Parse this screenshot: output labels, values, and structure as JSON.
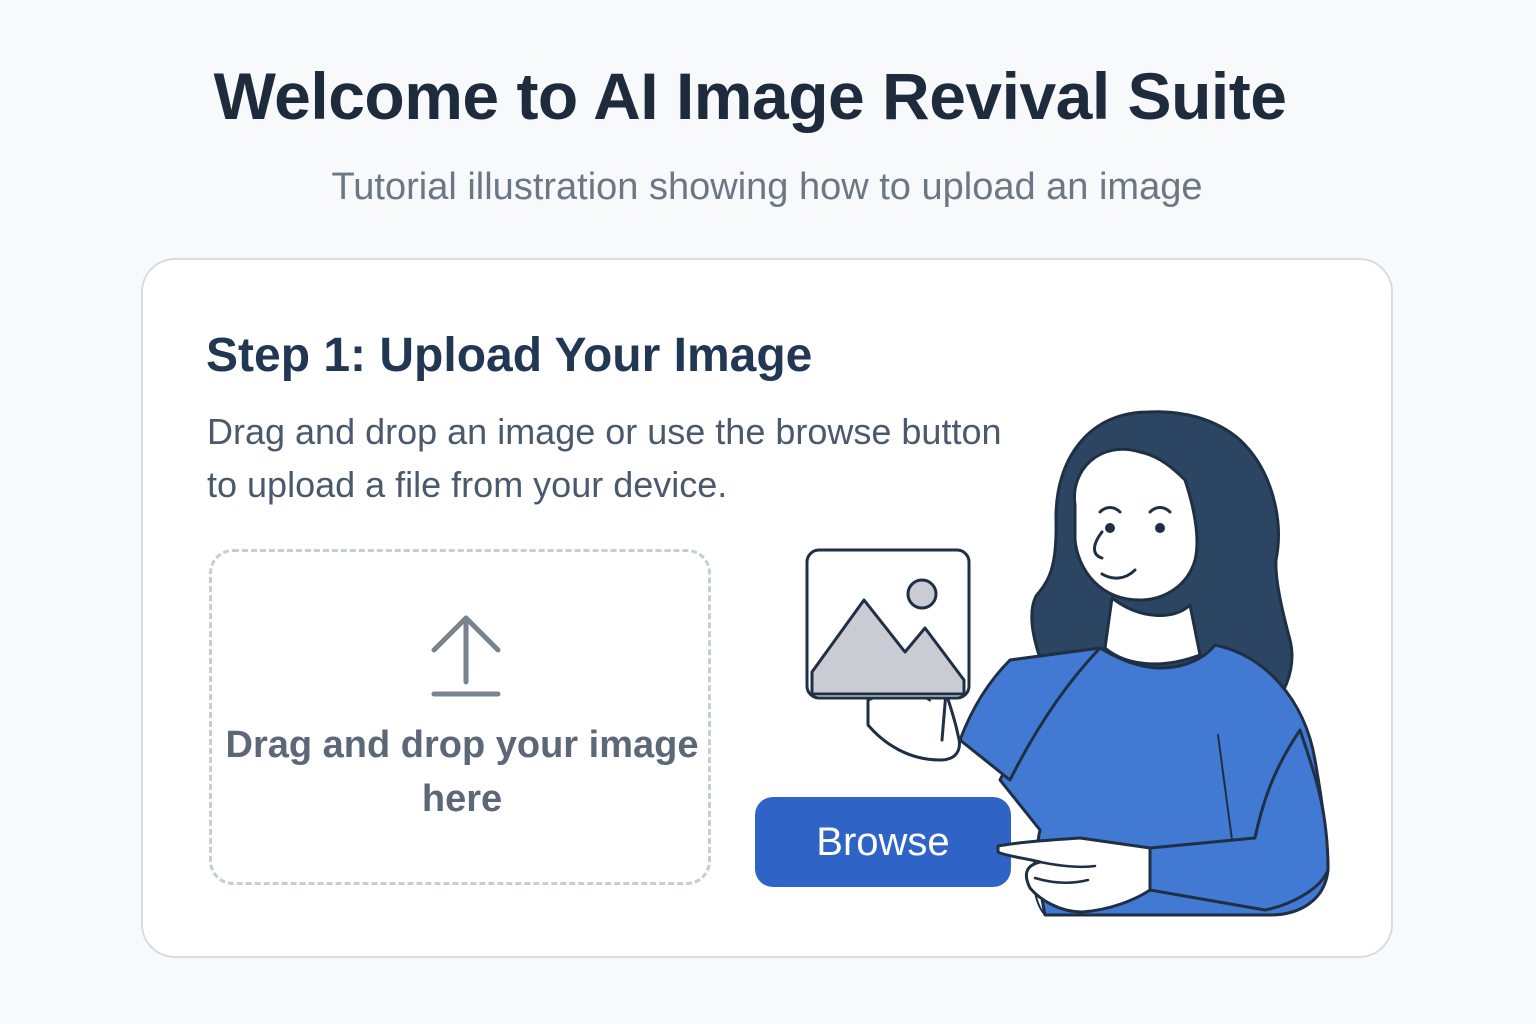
{
  "header": {
    "title": "Welcome to AI Image Revival Suite",
    "subtitle": "Tutorial illustration showing how to upload an image"
  },
  "step": {
    "title": "Step 1: Upload Your Image",
    "description": "Drag and drop an image or use the browse button to upload a file from your device."
  },
  "dropzone": {
    "text": "Drag and drop your image here",
    "icon": "upload-arrow-icon"
  },
  "browse": {
    "label": "Browse"
  },
  "illustration": {
    "subject": "woman-holding-image-icon",
    "colors": {
      "hair": "#2b4563",
      "sweater": "#4179d3",
      "outline": "#1f2f44",
      "skin": "#ffffff",
      "button": "#2f63c5",
      "photo_fill": "#c9ccd2"
    }
  }
}
